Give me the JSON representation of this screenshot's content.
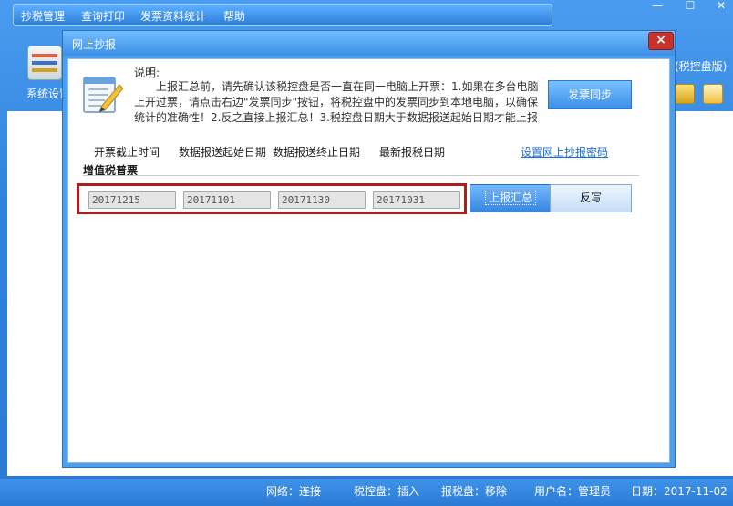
{
  "menubar": {
    "items": [
      "抄税管理",
      "查询打印",
      "发票资料统计",
      "帮助"
    ]
  },
  "window_controls": {
    "minimize": "—",
    "maximize": "☐",
    "close": "✕"
  },
  "toolbar": {
    "system_settings_label": "系统设置",
    "right_label": "(税控盘版)"
  },
  "dialog": {
    "title": "网上抄报",
    "close_label": "×",
    "notice_label": "说明:",
    "notice_text": "上报汇总前，请先确认该税控盘是否一直在同一电脑上开票：1.如果在多台电脑上开过票，请点击右边\"发票同步\"按钮，将税控盘中的发票同步到本地电脑，以确保统计的准确性！2.反之直接上报汇总！3.税控盘日期大于数据报送起始日期才能上报",
    "sync_button": "发票同步",
    "columns": [
      "开票截止时间",
      "数据报送起始日期",
      "数据报送终止日期",
      "最新报税日期"
    ],
    "set_password_link": "设置网上抄报密码",
    "section_title": "增值税普票",
    "dates": [
      "20171215",
      "20171101",
      "20171130",
      "20171031"
    ],
    "upload_button": "上报汇总",
    "reverse_button": "反写"
  },
  "statusbar": {
    "network": "网络：连接",
    "tax_disk": "税控盘：插入",
    "report_disk": "报税盘：移除",
    "username": "用户名：管理员",
    "date": "日期：2017-11-02"
  },
  "colors": {
    "accent": "#3b8fe0",
    "highlight_border": "#b01d1d",
    "link": "#1d6fd6"
  }
}
